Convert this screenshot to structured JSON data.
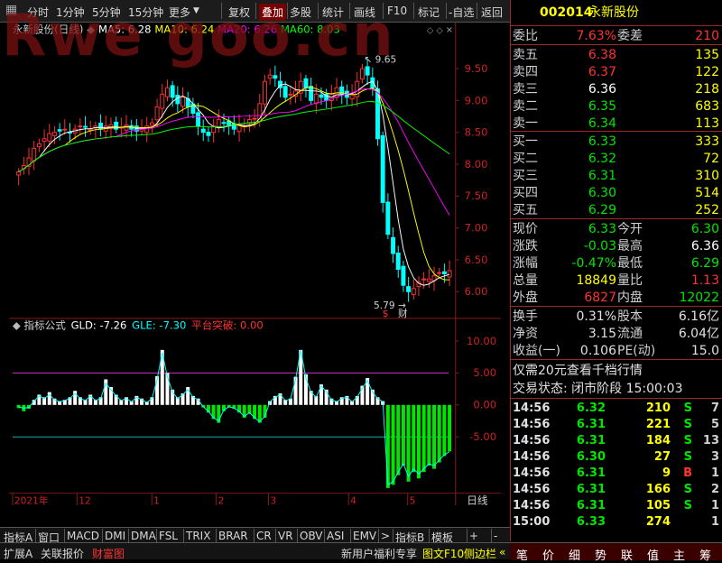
{
  "toolbar": {
    "items": [
      "分时",
      "1分钟",
      "5分钟",
      "15分钟",
      "更多",
      "复权",
      "叠加",
      "多股",
      "统计",
      "画线",
      "F10",
      "标记",
      "-自选",
      "返回"
    ],
    "active": "叠加"
  },
  "watermark": "Rwe goo.cn",
  "chart": {
    "stock_name": "永新股份(日线)",
    "ma_legend": [
      {
        "label": "MA5: 6.28",
        "color": "#ffffff"
      },
      {
        "label": "MA10: 6.24",
        "color": "#ffff00"
      },
      {
        "label": "MA20: 6.26",
        "color": "#ff00ff"
      },
      {
        "label": "MA60: 8.03",
        "color": "#00ff00"
      }
    ],
    "high_marker": "9.65",
    "low_marker": "5.79",
    "event_markers": [
      "$",
      "财"
    ],
    "indicator_name": "指标公式",
    "ind_legend": [
      {
        "label": "GLD: -7.26",
        "color": "#ffffff"
      },
      {
        "label": "GLE: -7.30",
        "color": "#00ffff"
      },
      {
        "label": "平台突破: 0.00",
        "color": "#ff3333"
      }
    ],
    "timeline_labels": [
      "2021年",
      "12",
      "1",
      "2",
      "3",
      "4",
      "5"
    ],
    "timeline_right": "日线",
    "colors": {
      "up": "#ff3232",
      "down": "#00ffff",
      "axis": "#8b1a1a",
      "price_axis_text": "#cc2222"
    }
  },
  "chart_data": [
    {
      "type": "candlestick",
      "title": "永新股份(日线)",
      "y_ticks": [
        9.5,
        9.0,
        8.5,
        8.0,
        7.5,
        7.0,
        6.5,
        6.0
      ],
      "ylim": [
        5.65,
        9.95
      ],
      "x_ticks": [
        "2021年",
        "12",
        "1",
        "2",
        "3",
        "4",
        "5"
      ],
      "series": [
        {
          "name": "MA5",
          "value": 6.28
        },
        {
          "name": "MA10",
          "value": 6.24
        },
        {
          "name": "MA20",
          "value": 6.26
        },
        {
          "name": "MA60",
          "value": 8.03
        }
      ],
      "close_path": [
        7.88,
        7.98,
        8.1,
        8.25,
        8.32,
        8.4,
        8.48,
        8.5,
        8.52,
        8.55,
        8.5,
        8.55,
        8.6,
        8.58,
        8.55,
        8.6,
        8.55,
        8.6,
        8.62,
        8.55,
        8.58,
        8.62,
        8.55,
        8.52,
        8.55,
        8.6,
        8.65,
        8.9,
        9.1,
        9.2,
        9.05,
        8.95,
        9.05,
        8.9,
        8.8,
        8.6,
        8.5,
        8.45,
        8.6,
        8.7,
        8.65,
        8.6,
        8.55,
        8.62,
        8.6,
        8.7,
        8.72,
        8.95,
        9.3,
        9.4,
        9.35,
        9.2,
        9.05,
        9.1,
        9.15,
        9.3,
        9.2,
        9.0,
        9.1,
        9.05,
        9.0,
        9.1,
        9.2,
        9.1,
        9.05,
        9.1,
        9.3,
        9.5,
        9.4,
        9.2,
        8.4,
        7.4,
        6.9,
        6.6,
        6.35,
        6.1,
        6.0,
        6.05,
        6.15,
        6.2,
        6.2,
        6.25,
        6.3,
        6.28,
        6.33
      ],
      "high": 9.65,
      "low": 5.79
    },
    {
      "type": "bar",
      "title": "指标公式",
      "y_ticks": [
        10.0,
        5.0,
        0.0,
        -5.0
      ],
      "ylim": [
        -13.0,
        11.5
      ],
      "reference_lines": [
        5.0,
        -5.0
      ],
      "series": [
        {
          "name": "GLD",
          "value": -7.26
        },
        {
          "name": "GLE",
          "value": -7.3
        },
        {
          "name": "平台突破",
          "value": 0.0
        }
      ],
      "values": [
        -0.5,
        -1.0,
        -0.6,
        0.8,
        1.6,
        1.2,
        2.0,
        1.0,
        0.6,
        0.8,
        1.2,
        2.2,
        1.2,
        0.8,
        1.6,
        0.8,
        1.2,
        4.0,
        2.8,
        1.6,
        0.8,
        1.2,
        0.6,
        1.4,
        1.0,
        0.5,
        1.2,
        4.5,
        8.6,
        5.0,
        2.4,
        1.2,
        1.8,
        2.8,
        1.4,
        1.0,
        -0.4,
        -1.2,
        -2.2,
        -2.8,
        -1.0,
        -0.4,
        -0.6,
        -1.2,
        -2.0,
        -1.4,
        -2.2,
        -2.8,
        -2.0,
        0.6,
        1.4,
        1.8,
        0.8,
        1.0,
        4.4,
        8.6,
        4.8,
        2.2,
        1.4,
        3.2,
        2.4,
        1.0,
        0.6,
        1.2,
        1.4,
        0.6,
        1.4,
        3.0,
        4.2,
        2.4,
        1.2,
        0.6,
        -13.0,
        -12.5,
        -11.0,
        -9.5,
        -12.0,
        -10.5,
        -11.5,
        -10.5,
        -9.5,
        -10.0,
        -9.0,
        -8.0,
        -7.26
      ],
      "gle_path": [
        -0.3,
        -0.5,
        -0.4,
        0.6,
        1.4,
        1.0,
        1.6,
        0.8,
        0.5,
        0.7,
        1.0,
        1.8,
        1.0,
        0.7,
        1.4,
        0.7,
        1.0,
        3.4,
        2.4,
        1.4,
        0.7,
        1.0,
        0.5,
        1.2,
        0.8,
        0.4,
        1.0,
        4.0,
        8.2,
        4.4,
        2.0,
        1.0,
        1.6,
        2.4,
        1.2,
        0.8,
        -0.3,
        -1.0,
        -2.0,
        -2.5,
        -0.8,
        -0.3,
        -0.5,
        -1.0,
        -1.8,
        -1.2,
        -2.0,
        -2.6,
        -1.8,
        0.5,
        1.2,
        1.6,
        0.7,
        0.9,
        4.0,
        8.6,
        4.2,
        2.0,
        1.2,
        3.0,
        2.0,
        0.8,
        0.5,
        1.0,
        1.2,
        0.5,
        1.2,
        2.6,
        3.8,
        2.0,
        1.0,
        0.5,
        -12.5,
        -12.0,
        -10.5,
        -9.2,
        -11.2,
        -10.0,
        -10.8,
        -10.0,
        -9.2,
        -9.5,
        -8.6,
        -7.8,
        -7.3
      ]
    }
  ],
  "quote": {
    "code": "002014",
    "name": "永新股份",
    "weibi_label": "委比",
    "weibi_value": "7.63%",
    "weicha_label": "委差",
    "weicha_value": "210",
    "asks": [
      {
        "label": "卖五",
        "price": "6.38",
        "vol": "135",
        "color": "#ff3232"
      },
      {
        "label": "卖四",
        "price": "6.37",
        "vol": "122",
        "color": "#ff3232"
      },
      {
        "label": "卖三",
        "price": "6.36",
        "vol": "218",
        "color": "#ffffff"
      },
      {
        "label": "卖二",
        "price": "6.35",
        "vol": "683",
        "color": "#00e600"
      },
      {
        "label": "卖一",
        "price": "6.34",
        "vol": "113",
        "color": "#00e600"
      }
    ],
    "bids": [
      {
        "label": "买一",
        "price": "6.33",
        "vol": "333",
        "color": "#00e600"
      },
      {
        "label": "买二",
        "price": "6.32",
        "vol": "72",
        "color": "#00e600"
      },
      {
        "label": "买三",
        "price": "6.31",
        "vol": "310",
        "color": "#00e600"
      },
      {
        "label": "买四",
        "price": "6.30",
        "vol": "514",
        "color": "#00e600"
      },
      {
        "label": "买五",
        "price": "6.29",
        "vol": "252",
        "color": "#00e600"
      }
    ],
    "stats": [
      {
        "l1": "现价",
        "v1": "6.33",
        "c1": "#00e600",
        "l2": "今开",
        "v2": "6.30",
        "c2": "#00e600"
      },
      {
        "l1": "涨跌",
        "v1": "-0.03",
        "c1": "#00e600",
        "l2": "最高",
        "v2": "6.36",
        "c2": "#ffffff"
      },
      {
        "l1": "涨幅",
        "v1": "-0.47%",
        "c1": "#00e600",
        "l2": "最低",
        "v2": "6.29",
        "c2": "#00e600"
      },
      {
        "l1": "总量",
        "v1": "18849",
        "c1": "#ffff00",
        "l2": "量比",
        "v2": "1.13",
        "c2": "#ff3232"
      },
      {
        "l1": "外盘",
        "v1": "6827",
        "c1": "#ff3232",
        "l2": "内盘",
        "v2": "12022",
        "c2": "#00e600"
      }
    ],
    "fund": [
      {
        "l1": "换手",
        "v1": "0.31%",
        "l2": "股本",
        "v2": "6.16亿"
      },
      {
        "l1": "净资",
        "v1": "3.15",
        "l2": "流通",
        "v2": "6.04亿"
      },
      {
        "l1": "收益(一)",
        "v1": "0.106",
        "l2": "PE(动)",
        "v2": "15.0"
      }
    ],
    "promo": "仅需20元查看千档行情",
    "trade_status": "交易状态: 闭市阶段 15:00:03",
    "ticks": [
      {
        "time": "14:56",
        "price": "6.32",
        "vol": "210",
        "side": "S",
        "side_color": "#00e600",
        "n": "7"
      },
      {
        "time": "14:56",
        "price": "6.31",
        "vol": "221",
        "side": "S",
        "side_color": "#00e600",
        "n": "5"
      },
      {
        "time": "14:56",
        "price": "6.31",
        "vol": "184",
        "side": "S",
        "side_color": "#00e600",
        "n": "13"
      },
      {
        "time": "14:56",
        "price": "6.30",
        "vol": "27",
        "side": "S",
        "side_color": "#00e600",
        "n": "3"
      },
      {
        "time": "14:56",
        "price": "6.31",
        "vol": "9",
        "side": "B",
        "side_color": "#ff3232",
        "n": "1"
      },
      {
        "time": "14:56",
        "price": "6.31",
        "vol": "166",
        "side": "S",
        "side_color": "#00e600",
        "n": "2"
      },
      {
        "time": "14:56",
        "price": "6.31",
        "vol": "105",
        "side": "S",
        "side_color": "#00e600",
        "n": "1"
      },
      {
        "time": "15:00",
        "price": "6.33",
        "vol": "274",
        "side": "",
        "side_color": "#00e600",
        "n": "1"
      }
    ]
  },
  "bottom_tabs": [
    "指标A",
    "窗口",
    "MACD",
    "DMI",
    "DMA",
    "FSL",
    "TRIX",
    "BRAR",
    "CR",
    "VR",
    "OBV",
    "ASI",
    "EMV",
    ">",
    "指标B",
    "模板",
    "+",
    "-"
  ],
  "statusbar": {
    "left": [
      "扩展A",
      "关联报价",
      "财富图"
    ],
    "promo": "新用户福利专享",
    "right_links": [
      "图文F10",
      "侧边栏"
    ],
    "icons": [
      "笔",
      "价",
      "细",
      "势",
      "联",
      "值",
      "主",
      "筹"
    ]
  }
}
